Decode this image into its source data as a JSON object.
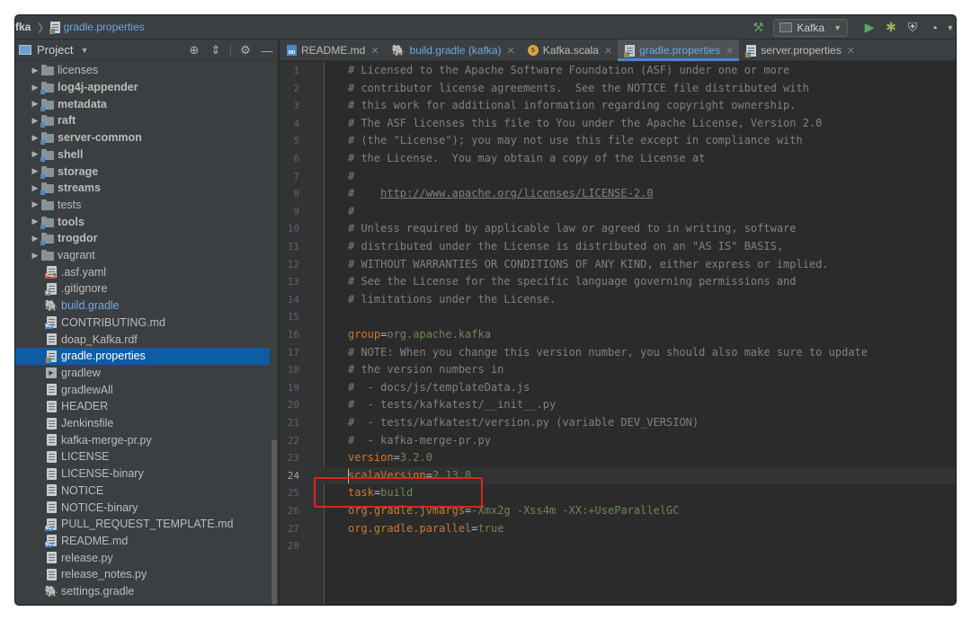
{
  "titlebar": {
    "project": "fka",
    "file": "gradle.properties",
    "run_config": "Kafka"
  },
  "project_panel": {
    "title": "Project",
    "items": [
      {
        "label": "licenses",
        "kind": "folder"
      },
      {
        "label": "log4j-appender",
        "kind": "module"
      },
      {
        "label": "metadata",
        "kind": "module"
      },
      {
        "label": "raft",
        "kind": "module"
      },
      {
        "label": "server-common",
        "kind": "module"
      },
      {
        "label": "shell",
        "kind": "module"
      },
      {
        "label": "storage",
        "kind": "module"
      },
      {
        "label": "streams",
        "kind": "module"
      },
      {
        "label": "tests",
        "kind": "folder"
      },
      {
        "label": "tools",
        "kind": "module"
      },
      {
        "label": "trogdor",
        "kind": "module"
      },
      {
        "label": "vagrant",
        "kind": "folder"
      },
      {
        "label": ".asf.yaml",
        "kind": "yaml"
      },
      {
        "label": ".gitignore",
        "kind": "git"
      },
      {
        "label": "build.gradle",
        "kind": "gradle"
      },
      {
        "label": "CONTRIBUTING.md",
        "kind": "md"
      },
      {
        "label": "doap_Kafka.rdf",
        "kind": "file"
      },
      {
        "label": "gradle.properties",
        "kind": "props"
      },
      {
        "label": "gradlew",
        "kind": "exec"
      },
      {
        "label": "gradlewAll",
        "kind": "file"
      },
      {
        "label": "HEADER",
        "kind": "file"
      },
      {
        "label": "Jenkinsfile",
        "kind": "file"
      },
      {
        "label": "kafka-merge-pr.py",
        "kind": "file"
      },
      {
        "label": "LICENSE",
        "kind": "file"
      },
      {
        "label": "LICENSE-binary",
        "kind": "file"
      },
      {
        "label": "NOTICE",
        "kind": "file"
      },
      {
        "label": "NOTICE-binary",
        "kind": "file"
      },
      {
        "label": "PULL_REQUEST_TEMPLATE.md",
        "kind": "md"
      },
      {
        "label": "README.md",
        "kind": "md"
      },
      {
        "label": "release.py",
        "kind": "file"
      },
      {
        "label": "release_notes.py",
        "kind": "file"
      },
      {
        "label": "settings.gradle",
        "kind": "gradle"
      }
    ],
    "selected_index": 17
  },
  "tabs": [
    {
      "label": "README.md",
      "icon": "markdown-icon",
      "active": false
    },
    {
      "label": "build.gradle (kafka)",
      "icon": "gradle-icon",
      "active": false
    },
    {
      "label": "Kafka.scala",
      "icon": "scala-icon",
      "active": false
    },
    {
      "label": "gradle.properties",
      "icon": "properties-icon",
      "active": true
    },
    {
      "label": "server.properties",
      "icon": "properties-icon",
      "active": false
    }
  ],
  "editor": {
    "current_line": 24,
    "lines": [
      {
        "type": "comment",
        "text": "# Licensed to the Apache Software Foundation (ASF) under one or more"
      },
      {
        "type": "comment",
        "text": "# contributor license agreements.  See the NOTICE file distributed with"
      },
      {
        "type": "comment",
        "text": "# this work for additional information regarding copyright ownership."
      },
      {
        "type": "comment",
        "text": "# The ASF licenses this file to You under the Apache License, Version 2.0"
      },
      {
        "type": "comment",
        "text": "# (the \"License\"); you may not use this file except in compliance with"
      },
      {
        "type": "comment",
        "text": "# the License.  You may obtain a copy of the License at"
      },
      {
        "type": "comment",
        "text": "#"
      },
      {
        "type": "url",
        "prefix": "#    ",
        "text": "http://www.apache.org/licenses/LICENSE-2.0"
      },
      {
        "type": "comment",
        "text": "#"
      },
      {
        "type": "comment",
        "text": "# Unless required by applicable law or agreed to in writing, software"
      },
      {
        "type": "comment",
        "text": "# distributed under the License is distributed on an \"AS IS\" BASIS,"
      },
      {
        "type": "comment",
        "text": "# WITHOUT WARRANTIES OR CONDITIONS OF ANY KIND, either express or implied."
      },
      {
        "type": "comment",
        "text": "# See the License for the specific language governing permissions and"
      },
      {
        "type": "comment",
        "text": "# limitations under the License."
      },
      {
        "type": "blank",
        "text": ""
      },
      {
        "type": "prop",
        "key": "group",
        "value": "org.apache.kafka"
      },
      {
        "type": "comment",
        "text": "# NOTE: When you change this version number, you should also make sure to update"
      },
      {
        "type": "comment",
        "text": "# the version numbers in"
      },
      {
        "type": "comment",
        "text": "#  - docs/js/templateData.js"
      },
      {
        "type": "comment",
        "text": "#  - tests/kafkatest/__init__.py"
      },
      {
        "type": "comment",
        "text": "#  - tests/kafkatest/version.py (variable DEV_VERSION)"
      },
      {
        "type": "comment",
        "text": "#  - kafka-merge-pr.py"
      },
      {
        "type": "prop",
        "key": "version",
        "value": "3.2.0"
      },
      {
        "type": "prop",
        "key": "scalaVersion",
        "value": "2.13.8"
      },
      {
        "type": "prop",
        "key": "task",
        "value": "build"
      },
      {
        "type": "prop",
        "key": "org.gradle.jvmargs",
        "value": "-Xmx2g -Xss4m -XX:+UseParallelGC"
      },
      {
        "type": "prop",
        "key": "org.gradle.parallel",
        "value": "true"
      },
      {
        "type": "blank",
        "text": ""
      }
    ]
  },
  "colors": {
    "accent": "#4a88c7",
    "selection": "#0d5ca6",
    "highlight_box": "#e0231d",
    "prop_key": "#cc7832",
    "prop_value": "#6a8759",
    "comment": "#808080"
  }
}
